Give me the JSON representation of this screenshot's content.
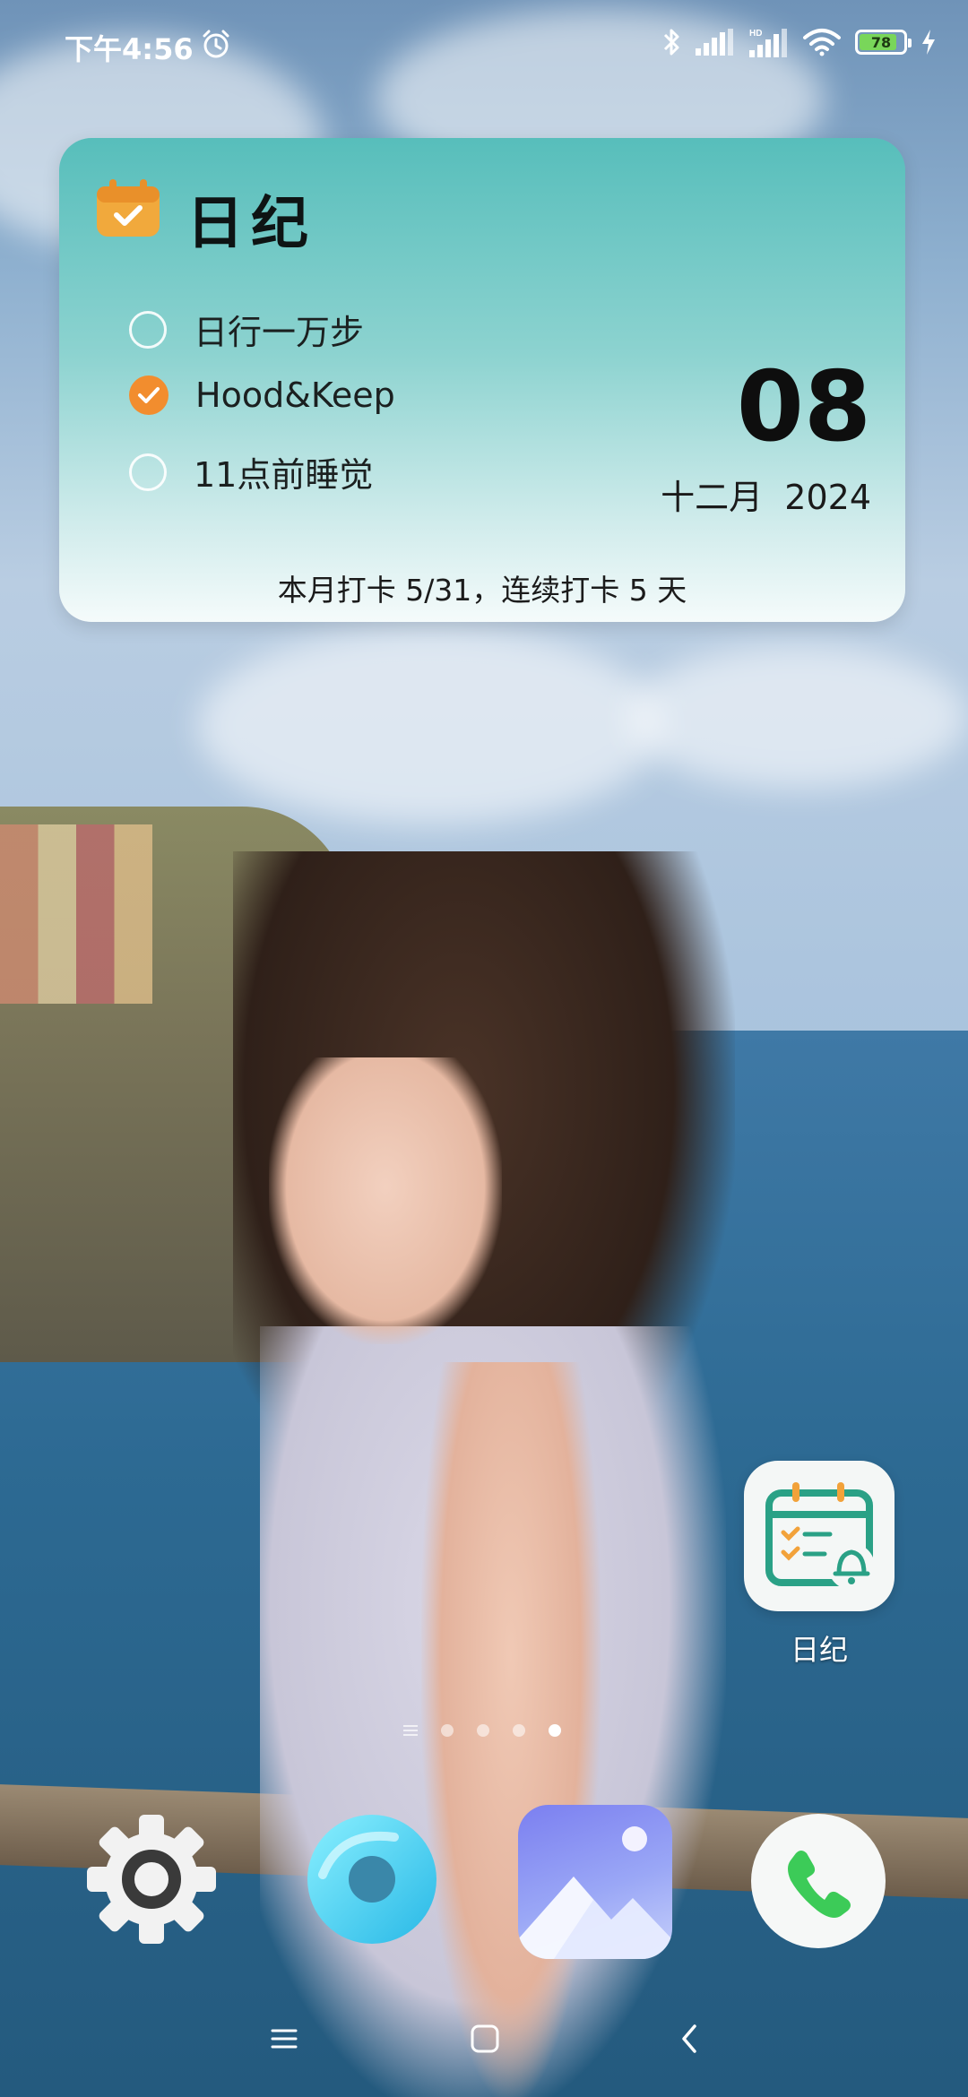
{
  "status_bar": {
    "time": "下午4:56",
    "battery": "78",
    "accent_battery": "#79d65a"
  },
  "widget": {
    "title": "日纪",
    "tasks": [
      {
        "label": "日行一万步",
        "done": false
      },
      {
        "label": "Hood&Keep",
        "done": true
      },
      {
        "label": "11点前睡觉",
        "done": false
      }
    ],
    "day": "08",
    "month_year": "十二月  2024",
    "summary": "本月打卡 5/31，连续打卡 5 天",
    "accent": "#f28d2e"
  },
  "app": {
    "label": "日纪",
    "icon": "calendar-bell-icon"
  },
  "pager": {
    "pages": 4,
    "active_page": 4
  },
  "dock": [
    {
      "icon": "settings-gear-icon"
    },
    {
      "icon": "browser-ring-icon"
    },
    {
      "icon": "gallery-mountain-icon"
    },
    {
      "icon": "phone-handset-icon"
    }
  ],
  "nav": {
    "buttons": [
      "menu-icon",
      "home-icon",
      "back-icon"
    ]
  }
}
